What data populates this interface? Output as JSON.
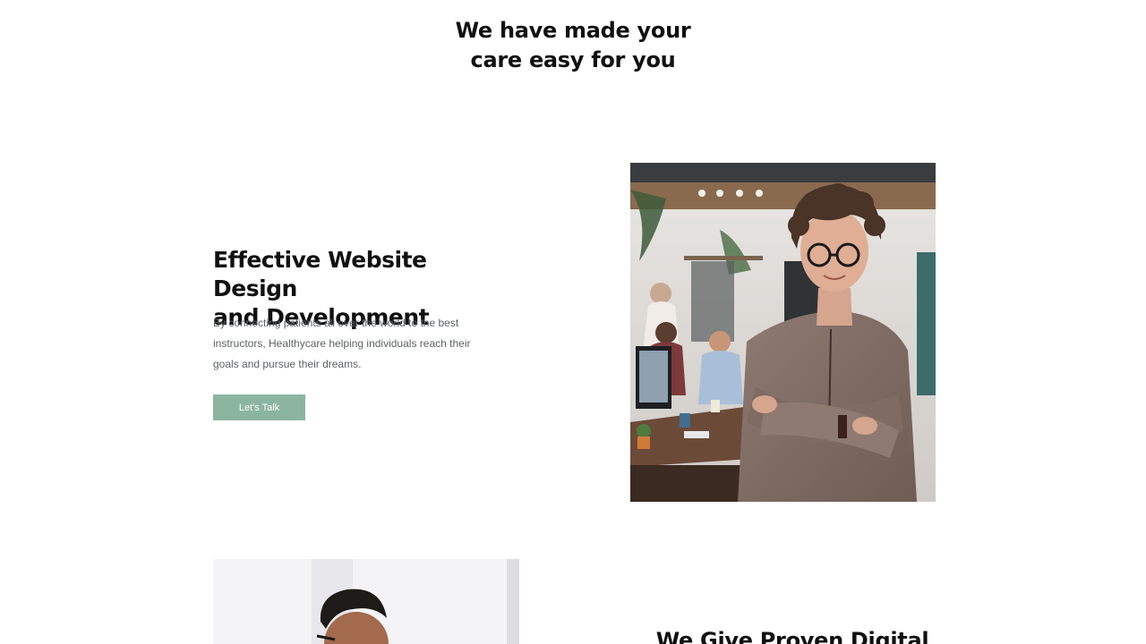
{
  "section": {
    "title_line1": "We have made your",
    "title_line2": "care easy for you"
  },
  "feature": {
    "title_line1": "Effective Website Design",
    "title_line2": "and Development",
    "description": "By connecting patients all over the world to the best instructors, Healthycare helping individuals reach their goals and pursue their dreams.",
    "button_label": "Let's Talk"
  },
  "next_section": {
    "title": "We Give Proven Digital"
  },
  "colors": {
    "accent": "#8cb5a1",
    "heading": "#111111",
    "body_text": "#5d6166"
  }
}
